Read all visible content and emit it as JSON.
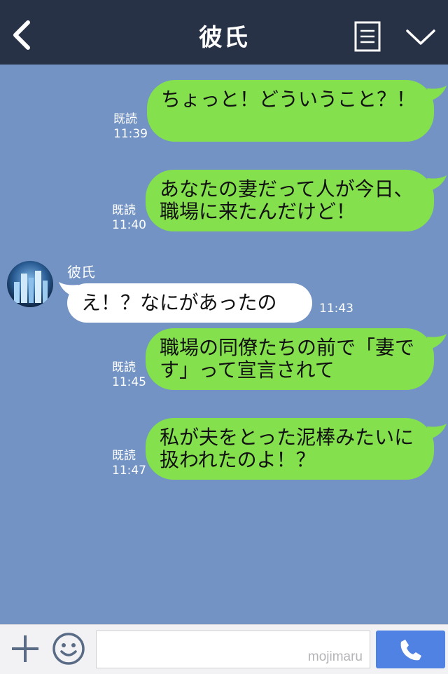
{
  "header": {
    "title": "彼氏",
    "icons": [
      "back-icon",
      "notes-icon",
      "chevron-down-icon"
    ]
  },
  "messages": [
    {
      "side": "out",
      "text": "ちょっと！どういうこと？！",
      "read": "既読",
      "time": "11:39"
    },
    {
      "side": "out",
      "text": "あなたの妻だって人が今日、職場に来たんだけど！",
      "read": "既読",
      "time": "11:40"
    },
    {
      "side": "in",
      "sender": "彼氏",
      "text": "え！？なにがあったの",
      "time": "11:43"
    },
    {
      "side": "out",
      "text": "職場の同僚たちの前で「妻です」って宣言されて",
      "read": "既読",
      "time": "11:45"
    },
    {
      "side": "out",
      "text": "私が夫をとった泥棒みたいに扱われたのよ！？",
      "read": "既読",
      "time": "11:47"
    }
  ],
  "footer": {
    "watermark": "mojimaru",
    "icons": [
      "plus-icon",
      "smile-icon",
      "phone-icon"
    ]
  },
  "colors": {
    "header_bg": "#273247",
    "chat_bg": "#7293c4",
    "outgoing_bubble": "#84e04d",
    "incoming_bubble": "#ffffff",
    "call_button": "#4f82e2"
  }
}
